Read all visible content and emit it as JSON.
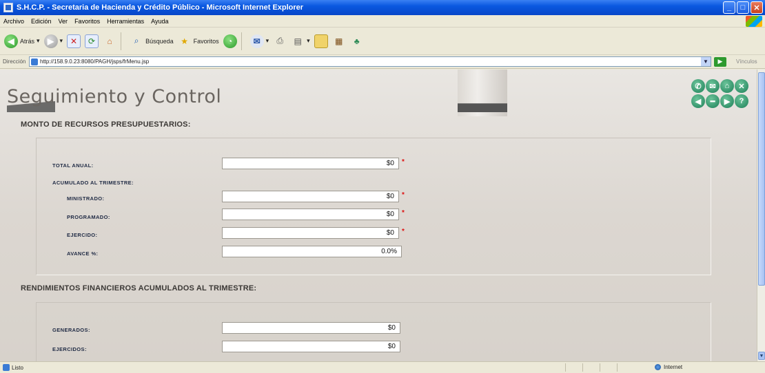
{
  "window": {
    "title": "S.H.C.P. - Secretaria de Hacienda y Crédito Público - Microsoft Internet Explorer",
    "min": "_",
    "max": "□",
    "close": "✕"
  },
  "menu": [
    "Archivo",
    "Edición",
    "Ver",
    "Favoritos",
    "Herramientas",
    "Ayuda"
  ],
  "toolbar": {
    "back": "Atrás",
    "search": "Búsqueda",
    "favorites": "Favoritos"
  },
  "address": {
    "label": "Dirección",
    "url": "http://158.9.0.23:8080/PAGH/jsps/frMenu.jsp",
    "go": "▶",
    "links": "Vínculos"
  },
  "page": {
    "title": "Seguimiento y Control",
    "section1": "MONTO DE RECURSOS PRESUPUESTARIOS:",
    "section2": "RENDIMIENTOS FINANCIEROS ACUMULADOS AL TRIMESTRE:",
    "sub_acumulado": "ACUMULADO AL TRIMESTRE:",
    "fields": [
      {
        "label": "TOTAL ANUAL:",
        "value": "$0",
        "required": true
      },
      {
        "label": "MINISTRADO:",
        "value": "$0",
        "required": true
      },
      {
        "label": "PROGRAMADO:",
        "value": "$0",
        "required": true
      },
      {
        "label": "EJERCIDO:",
        "value": "$0",
        "required": true
      },
      {
        "label": "AVANCE %:",
        "value": "0.0%",
        "required": false
      }
    ],
    "fields2": [
      {
        "label": "GENERADOS:",
        "value": "$0"
      },
      {
        "label": "EJERCIDOS:",
        "value": "$0"
      }
    ],
    "required_mark": "*"
  },
  "status": {
    "left": "Listo",
    "zone": "Internet"
  }
}
